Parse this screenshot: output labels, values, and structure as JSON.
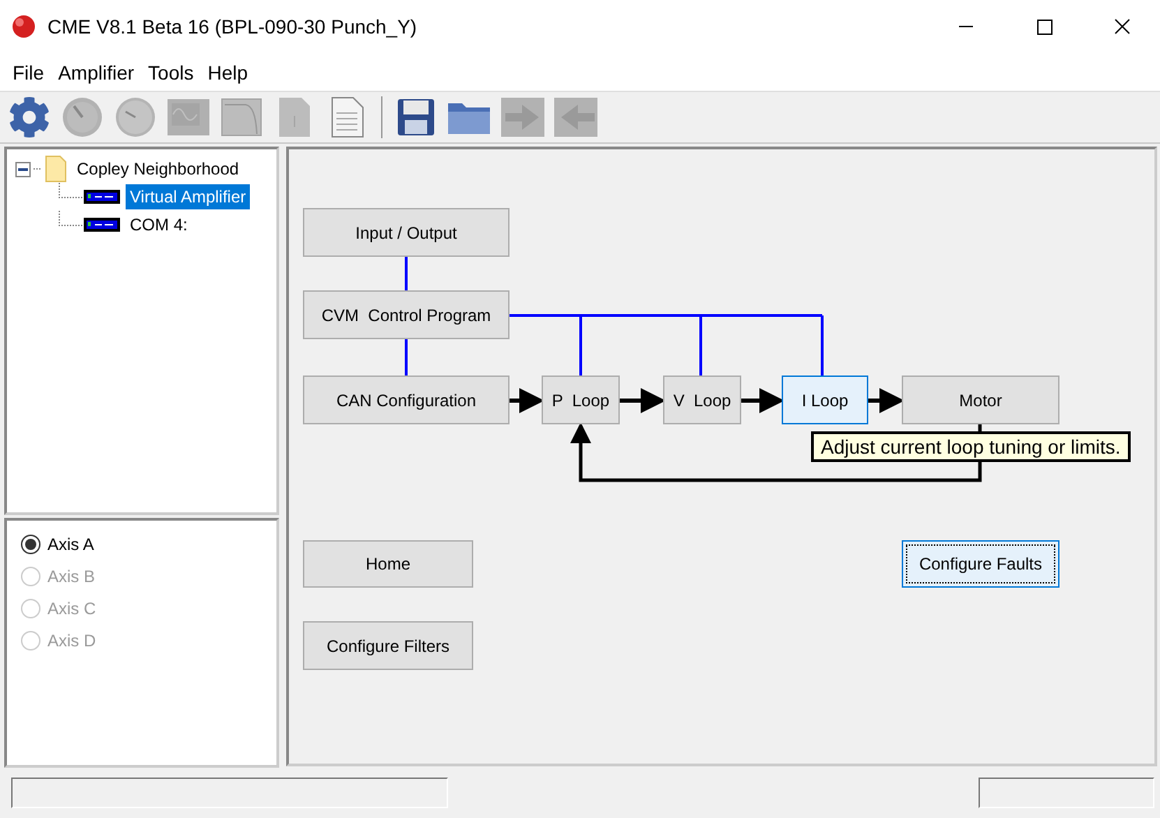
{
  "window": {
    "title": "CME V8.1 Beta 16 (BPL-090-30 Punch_Y)"
  },
  "menu": [
    {
      "label": "File"
    },
    {
      "label": "Amplifier"
    },
    {
      "label": "Tools"
    },
    {
      "label": "Help"
    }
  ],
  "toolbar": [
    {
      "kind": "gear",
      "disabled": false
    },
    {
      "kind": "gauge",
      "disabled": true
    },
    {
      "kind": "dial",
      "disabled": true
    },
    {
      "kind": "scope",
      "disabled": true
    },
    {
      "kind": "plot",
      "disabled": true
    },
    {
      "kind": "page",
      "disabled": true
    },
    {
      "kind": "document",
      "disabled": false
    },
    {
      "kind": "separator"
    },
    {
      "kind": "save",
      "disabled": false
    },
    {
      "kind": "folder",
      "disabled": false
    },
    {
      "kind": "send",
      "disabled": true
    },
    {
      "kind": "receive",
      "disabled": true
    }
  ],
  "tree": {
    "label": "Copley Neighborhood",
    "expanded": true,
    "children": [
      {
        "label": "Virtual Amplifier",
        "selected": true
      },
      {
        "label": "COM 4:",
        "selected": false
      }
    ]
  },
  "axes": [
    {
      "label": "Axis A",
      "selected": true,
      "disabled": false
    },
    {
      "label": "Axis B",
      "selected": false,
      "disabled": true
    },
    {
      "label": "Axis C",
      "selected": false,
      "disabled": true
    },
    {
      "label": "Axis D",
      "selected": false,
      "disabled": true
    }
  ],
  "diagram": {
    "blocks": [
      {
        "label": "Input / Output",
        "selected": false
      },
      {
        "label": "CVM  Control Program",
        "selected": false
      },
      {
        "label": "CAN Configuration",
        "selected": false
      },
      {
        "label": "P  Loop",
        "selected": false
      },
      {
        "label": "V  Loop",
        "selected": false
      },
      {
        "label": "I Loop",
        "selected": true
      },
      {
        "label": "Motor",
        "selected": false
      }
    ],
    "buttons": [
      {
        "label": "Home",
        "focused": false
      },
      {
        "label": "Configure Filters",
        "focused": false
      },
      {
        "label": "Configure Faults",
        "focused": true
      }
    ],
    "tooltip": "Adjust current loop tuning or limits."
  }
}
